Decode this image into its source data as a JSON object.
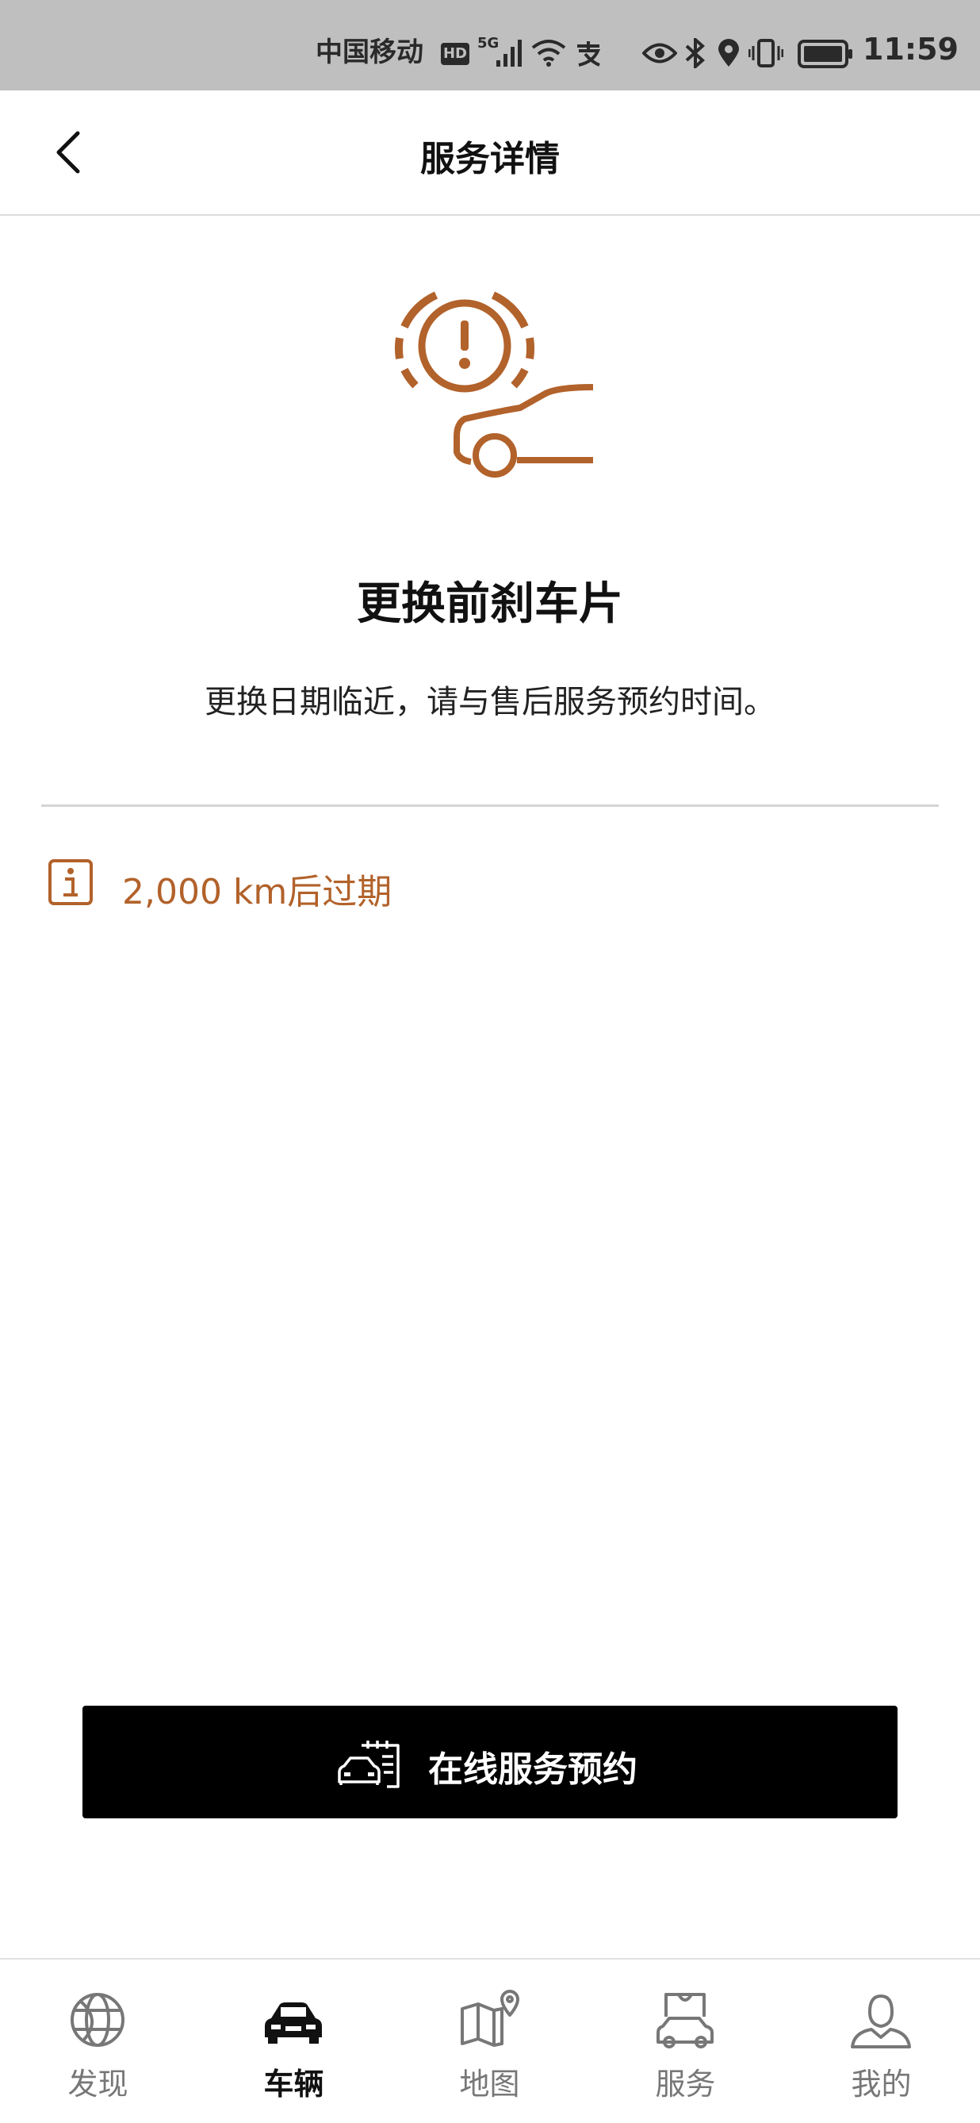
{
  "status_bar": {
    "carrier": "中国移动",
    "hd": "HD",
    "network": "5G",
    "time": "11:59"
  },
  "header": {
    "title": "服务详情",
    "back_icon": "chevron-left-icon"
  },
  "service": {
    "icon": "brake-warning-car-icon",
    "accent_color": "#b2622b",
    "title": "更换前刹车片",
    "description": "更换日期临近，请与售后服务预约时间。",
    "expiry_icon": "info-icon",
    "expiry_text": "2,000 km后过期"
  },
  "booking": {
    "icon": "car-calendar-icon",
    "label": "在线服务预约"
  },
  "bottom_nav": {
    "items": [
      {
        "label": "发现",
        "icon": "globe-icon",
        "active": false
      },
      {
        "label": "车辆",
        "icon": "car-icon",
        "active": true
      },
      {
        "label": "地图",
        "icon": "map-pin-icon",
        "active": false
      },
      {
        "label": "服务",
        "icon": "service-bag-car-icon",
        "active": false
      },
      {
        "label": "我的",
        "icon": "user-icon",
        "active": false
      }
    ]
  }
}
